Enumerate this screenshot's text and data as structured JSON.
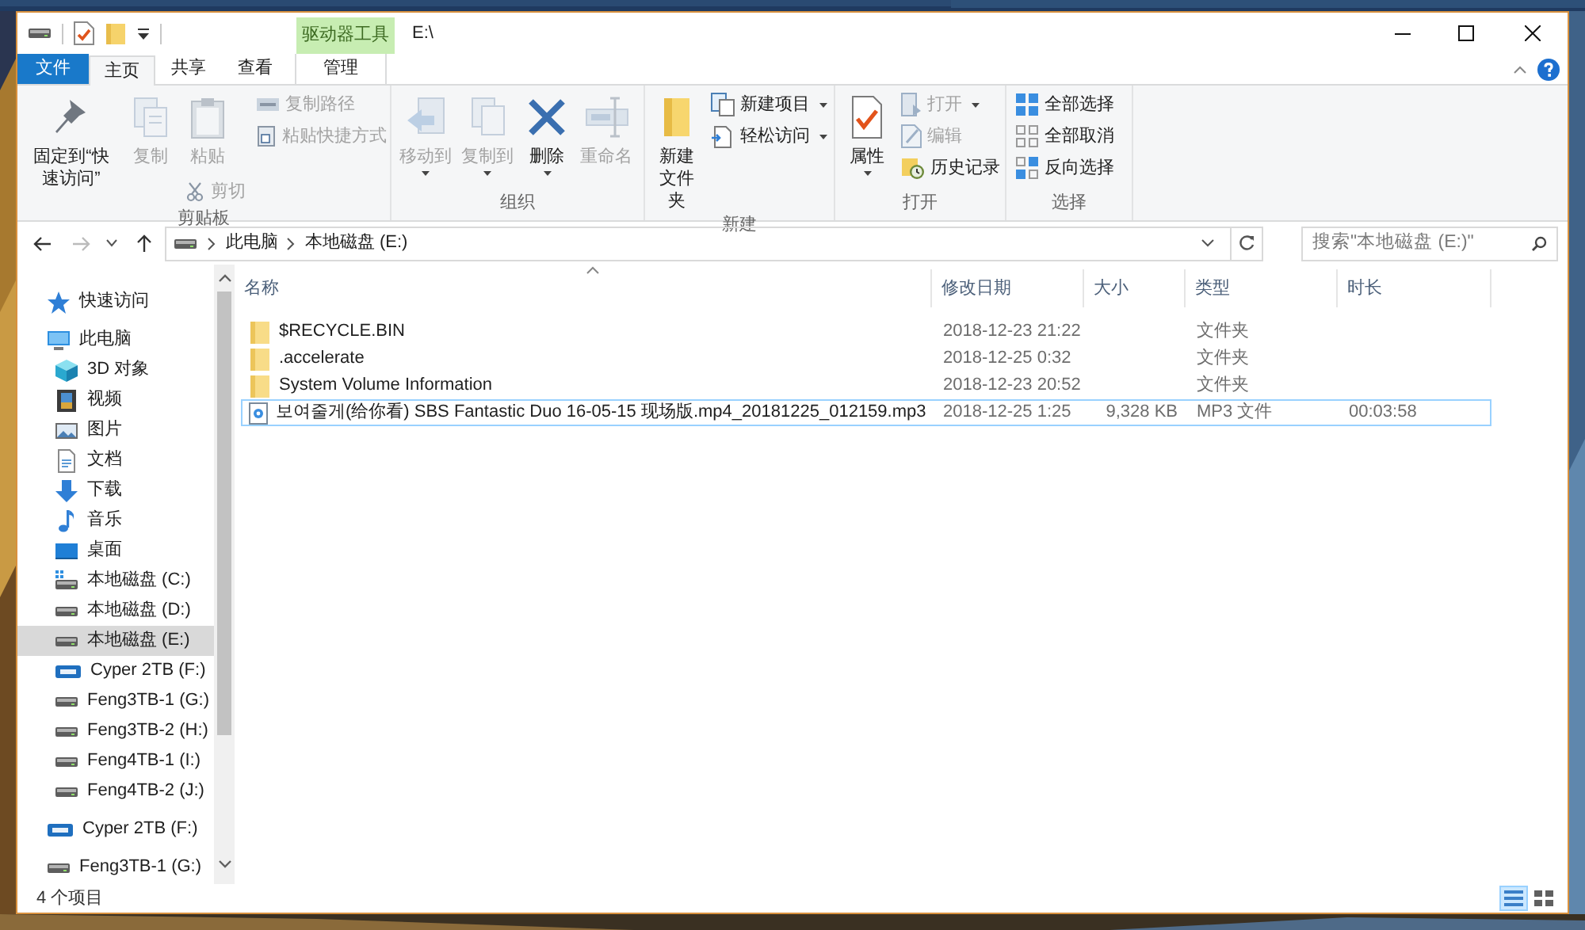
{
  "window": {
    "title": "E:\\",
    "context_tab_group": "驱动器工具"
  },
  "ribbon_tabs": [
    {
      "label": "文件",
      "kind": "file",
      "selected": false
    },
    {
      "label": "主页",
      "kind": "tab",
      "selected": true
    },
    {
      "label": "共享",
      "kind": "tab",
      "selected": false
    },
    {
      "label": "查看",
      "kind": "tab",
      "selected": false
    },
    {
      "label": "管理",
      "kind": "context",
      "selected": false
    }
  ],
  "ribbon_groups": [
    {
      "label": "剪贴板",
      "columns": [
        [
          {
            "label": "固定到“快速访问”",
            "kind": "large",
            "disabled": false,
            "dropdown": false
          }
        ],
        [
          {
            "label": "复制",
            "kind": "large",
            "disabled": true,
            "dropdown": false
          }
        ],
        [
          {
            "label": "粘贴",
            "kind": "large",
            "disabled": true,
            "dropdown": false
          },
          {
            "label": "剪切",
            "kind": "small",
            "disabled": true,
            "dropdown": false
          }
        ],
        [
          {
            "label": "复制路径",
            "kind": "small",
            "disabled": true,
            "dropdown": false
          },
          {
            "label": "粘贴快捷方式",
            "kind": "small",
            "disabled": true,
            "dropdown": false
          }
        ]
      ]
    },
    {
      "label": "组织",
      "columns": [
        [
          {
            "label": "移动到",
            "kind": "large",
            "disabled": true,
            "dropdown": true
          }
        ],
        [
          {
            "label": "复制到",
            "kind": "large",
            "disabled": true,
            "dropdown": true
          }
        ],
        [
          {
            "label": "删除",
            "kind": "large",
            "disabled": false,
            "dropdown": true
          }
        ],
        [
          {
            "label": "重命名",
            "kind": "large",
            "disabled": true,
            "dropdown": false
          }
        ]
      ]
    },
    {
      "label": "新建",
      "columns": [
        [
          {
            "label": "新建文件夹",
            "kind": "large",
            "disabled": false,
            "dropdown": false
          }
        ],
        [
          {
            "label": "新建项目",
            "kind": "small",
            "disabled": false,
            "dropdown": true
          },
          {
            "label": "轻松访问",
            "kind": "small",
            "disabled": false,
            "dropdown": true
          }
        ]
      ]
    },
    {
      "label": "打开",
      "columns": [
        [
          {
            "label": "属性",
            "kind": "large",
            "disabled": false,
            "dropdown": true
          }
        ],
        [
          {
            "label": "打开",
            "kind": "small",
            "disabled": true,
            "dropdown": true
          },
          {
            "label": "编辑",
            "kind": "small",
            "disabled": true,
            "dropdown": false
          },
          {
            "label": "历史记录",
            "kind": "small",
            "disabled": false,
            "dropdown": false
          }
        ]
      ]
    },
    {
      "label": "选择",
      "columns": [
        [
          {
            "label": "全部选择",
            "kind": "small",
            "disabled": false,
            "dropdown": false
          },
          {
            "label": "全部取消",
            "kind": "small",
            "disabled": false,
            "dropdown": false
          },
          {
            "label": "反向选择",
            "kind": "small",
            "disabled": false,
            "dropdown": false
          }
        ]
      ]
    }
  ],
  "address_bar": {
    "crumbs": [
      "此电脑",
      "本地磁盘 (E:)"
    ]
  },
  "search": {
    "placeholder": "搜索\"本地磁盘 (E:)\""
  },
  "navigation": {
    "items": [
      {
        "label": "快速访问",
        "kind": "star",
        "selected": false
      },
      {
        "label": "此电脑",
        "kind": "pc",
        "selected": false,
        "children": [
          {
            "label": "3D 对象",
            "kind": "cube",
            "selected": false
          },
          {
            "label": "视频",
            "kind": "video",
            "selected": false
          },
          {
            "label": "图片",
            "kind": "picture",
            "selected": false
          },
          {
            "label": "文档",
            "kind": "document",
            "selected": false
          },
          {
            "label": "下载",
            "kind": "download",
            "selected": false
          },
          {
            "label": "音乐",
            "kind": "music",
            "selected": false
          },
          {
            "label": "桌面",
            "kind": "desktop",
            "selected": false
          },
          {
            "label": "本地磁盘 (C:)",
            "kind": "system-drive",
            "selected": false
          },
          {
            "label": "本地磁盘 (D:)",
            "kind": "drive",
            "selected": false
          },
          {
            "label": "本地磁盘 (E:)",
            "kind": "drive",
            "selected": true
          },
          {
            "label": "Cyper 2TB (F:)",
            "kind": "wd-drive",
            "selected": false
          },
          {
            "label": "Feng3TB-1 (G:)",
            "kind": "drive",
            "selected": false
          },
          {
            "label": "Feng3TB-2 (H:)",
            "kind": "drive",
            "selected": false
          },
          {
            "label": "Feng4TB-1 (I:)",
            "kind": "drive",
            "selected": false
          },
          {
            "label": "Feng4TB-2 (J:)",
            "kind": "drive",
            "selected": false
          }
        ]
      },
      {
        "label": "Cyper 2TB (F:)",
        "kind": "wd-drive",
        "selected": false
      },
      {
        "label": "Feng3TB-1 (G:)",
        "kind": "drive",
        "selected": false
      }
    ]
  },
  "file_list": {
    "columns": [
      {
        "label": "名称",
        "sorted": true
      },
      {
        "label": "修改日期",
        "sorted": false
      },
      {
        "label": "大小",
        "sorted": false
      },
      {
        "label": "类型",
        "sorted": false
      },
      {
        "label": "时长",
        "sorted": false
      }
    ],
    "rows": [
      {
        "kind": "folder",
        "selected": false,
        "name": "$RECYCLE.BIN",
        "date": "2018-12-23 21:22",
        "type": "文件夹"
      },
      {
        "kind": "folder",
        "selected": false,
        "name": ".accelerate",
        "date": "2018-12-25 0:32",
        "type": "文件夹"
      },
      {
        "kind": "folder",
        "selected": false,
        "name": "System Volume Information",
        "date": "2018-12-23 20:52",
        "type": "文件夹"
      },
      {
        "kind": "audio",
        "selected": true,
        "name": "보여줄게(给你看) SBS Fantastic Duo 16-05-15 现场版.mp4_20181225_012159.mp3",
        "date": "2018-12-25 1:25",
        "size": "9,328 KB",
        "type": "MP3 文件",
        "duration": "00:03:58"
      }
    ]
  },
  "status_bar": {
    "item_count": "4 个项目"
  }
}
